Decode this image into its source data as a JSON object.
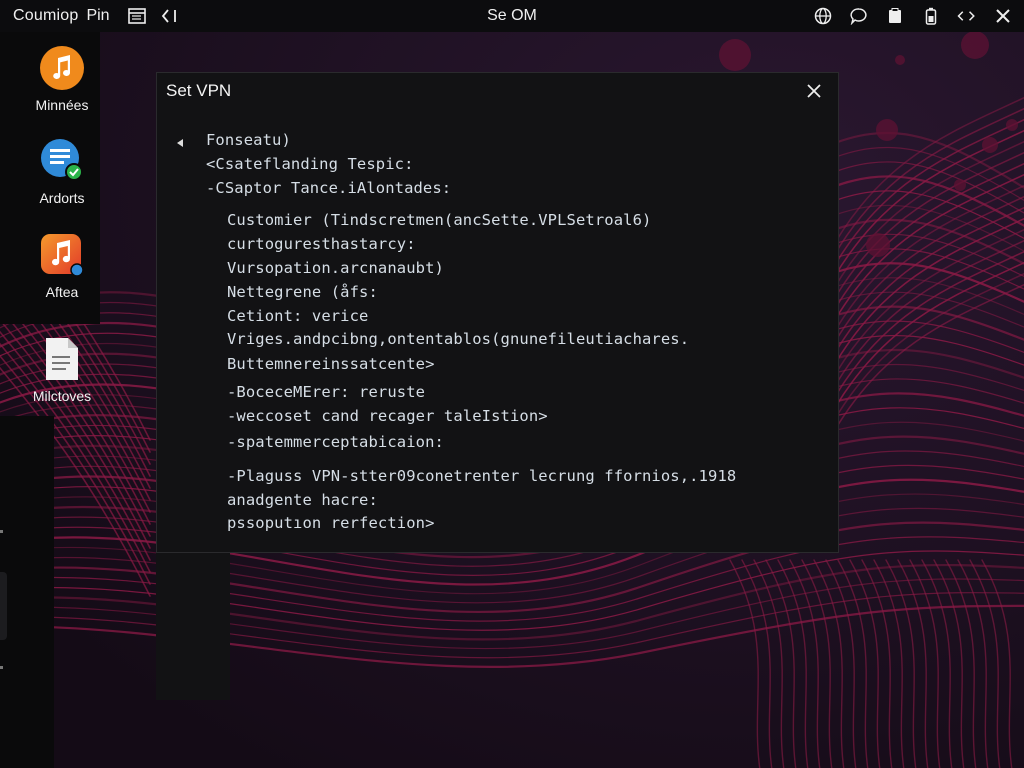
{
  "topbar": {
    "app_name": "Coumiop",
    "pin_label": "Pin",
    "center_title": "Se OM",
    "icons": [
      "window-icon",
      "code-icon",
      "globe-icon",
      "chat-icon",
      "clipboard-icon",
      "battery-icon",
      "nav-arrows-icon",
      "close-icon"
    ]
  },
  "desktop_icons": [
    {
      "label": "Minnées",
      "icon": "music-icon"
    },
    {
      "label": "Ardorts",
      "icon": "document-sync-icon"
    },
    {
      "label": "Aftea",
      "icon": "music-icon"
    },
    {
      "label": "Milctoves",
      "icon": "file-icon"
    }
  ],
  "dialog": {
    "title": "Set VPN",
    "lines": [
      "Fonseatu)",
      "<Csateflanding Tespic:",
      "-CSaptor Tance.iAlontades:",
      "Customier (Tindscretmen(ancSette.VPLSetroal6)",
      "curtoguresthastarcy:",
      "Vursopation.arcnanaubt)",
      "Nettegrene (åfs:",
      "Cetiont: verice",
      "Vriges.andpcibng,ontentablos(gnunefileutiachares.",
      "Buttemnereinssatcente>",
      "-BoceceMErer: reruste",
      "-weccoset cand recager taleIstion>",
      "-spatemmerceptabicaion:",
      "-Plaguss VPN-stter09conetrenter lecrung ffornios,.1918",
      "anadgente hacre:",
      "pssoputıon rerfection>"
    ]
  },
  "colors": {
    "topbar_bg": "#0c0c0e",
    "wallpaper_bg": "#1a0f1d",
    "wave_color": "#8b1a45",
    "dialog_bg": "#121214",
    "music_icon_orange": "#f08a1c",
    "music_icon_red": "#e83c2c"
  }
}
